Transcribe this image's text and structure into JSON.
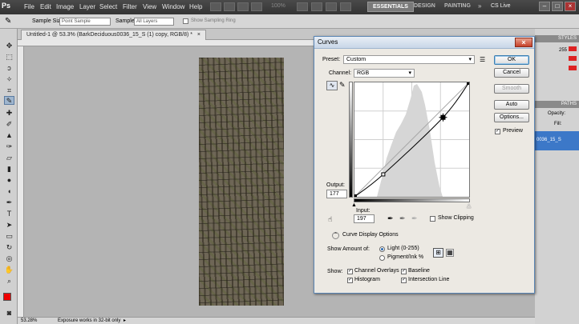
{
  "app": {
    "logo": "Ps",
    "menus": [
      "File",
      "Edit",
      "Image",
      "Layer",
      "Select",
      "Filter",
      "View",
      "Window",
      "Help"
    ],
    "zoom_readout": "100%",
    "workspaces": [
      "ESSENTIALS",
      "DESIGN",
      "PAINTING"
    ],
    "more": "»",
    "cs_live": "CS Live"
  },
  "options": {
    "sample_size_label": "Sample Size:",
    "sample_size_value": "Point Sample",
    "sample_label": "Sample:",
    "sample_value": "All Layers",
    "show_ring_label": "Show Sampling Ring"
  },
  "document": {
    "tab_title": "Untitled-1 @ 53.3% (BarkDeciduous0036_15_S (1) copy, RGB/8) *",
    "tab_close": "×"
  },
  "status": {
    "zoom": "53.28%",
    "message": "Exposure works in 32-bit only"
  },
  "panels": {
    "styles": "STYLES",
    "paths": "PATHS",
    "opacity": "Opacity:",
    "fill": "Fill:",
    "layer_name": "0036_15_S",
    "value_255": "255"
  },
  "curves": {
    "title": "Curves",
    "close": "×",
    "preset_label": "Preset:",
    "preset_value": "Custom",
    "channel_label": "Channel:",
    "channel_value": "RGB",
    "output_label": "Output:",
    "output_value": "177",
    "input_label": "Input:",
    "input_value": "197",
    "show_clipping": "Show Clipping",
    "display_options": "Curve Display Options",
    "show_amount_label": "Show Amount of:",
    "light_label": "Light  (0-255)",
    "pigment_label": "Pigment/Ink %",
    "show_label": "Show:",
    "channel_overlays": "Channel Overlays",
    "baseline": "Baseline",
    "histogram": "Histogram",
    "intersection_line": "Intersection Line",
    "buttons": {
      "ok": "OK",
      "cancel": "Cancel",
      "smooth": "Smooth",
      "auto": "Auto",
      "options": "Options..."
    },
    "preview_label": "Preview",
    "curve_points": [
      [
        0,
        0
      ],
      [
        64,
        50
      ],
      [
        197,
        177
      ],
      [
        255,
        255
      ]
    ]
  }
}
